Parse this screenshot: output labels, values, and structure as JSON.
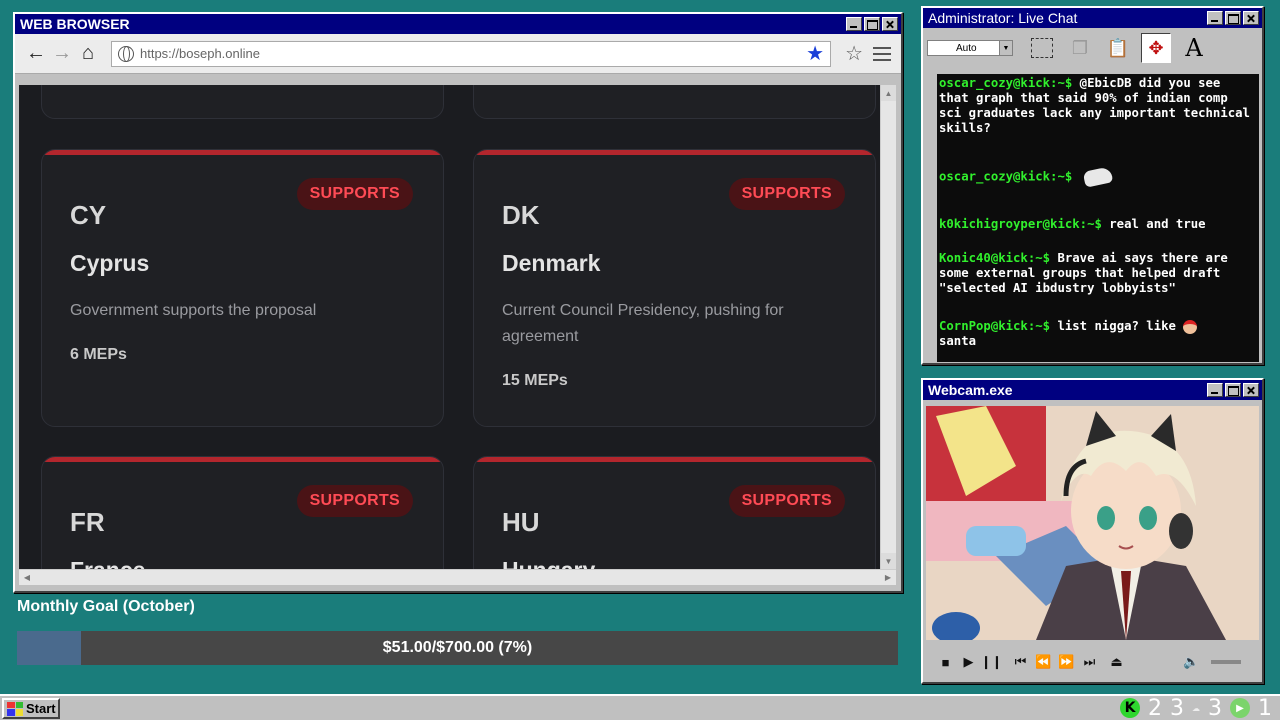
{
  "browser": {
    "title": "WEB BROWSER",
    "url": "https://boseph.online",
    "cards": [
      {
        "code": "CY",
        "name": "Cyprus",
        "badge": "SUPPORTS",
        "desc": "Government supports the proposal",
        "meps": "6 MEPs"
      },
      {
        "code": "DK",
        "name": "Denmark",
        "badge": "SUPPORTS",
        "desc": "Current Council Presidency, pushing for agreement",
        "meps": "15 MEPs"
      },
      {
        "code": "FR",
        "name": "France",
        "badge": "SUPPORTS"
      },
      {
        "code": "HU",
        "name": "Hungary",
        "badge": "SUPPORTS"
      }
    ]
  },
  "goal": {
    "title": "Monthly Goal (October)",
    "text": "$51.00/$700.00 (7%)",
    "progress": 0.073,
    "fill_color": "#4a6a8d"
  },
  "chat": {
    "title": "Administrator: Live Chat",
    "font_select": "Auto",
    "messages": [
      {
        "user": "oscar_cozy@kick:~$",
        "text": "@EbicDB did you see that graph that said 90% of indian comp sci graduates lack any important technical skills?"
      },
      {
        "user": "oscar_cozy@kick:~$",
        "text": ""
      },
      {
        "user": "k0kichigroyper@kick:~$",
        "text": "real and true"
      },
      {
        "user": "Konic40@kick:~$",
        "text": "Brave ai says there are some external groups that helped draft \"selected AI ibdustry lobbyists\""
      },
      {
        "user": "CornPop@kick:~$",
        "text": "list nigga? like",
        "text2": "santa"
      }
    ],
    "user_color": "#31f02d"
  },
  "webcam": {
    "title": "Webcam.exe"
  },
  "taskbar": {
    "start_label": "Start",
    "tray_numbers": [
      "2",
      "3",
      "3",
      "1"
    ]
  }
}
